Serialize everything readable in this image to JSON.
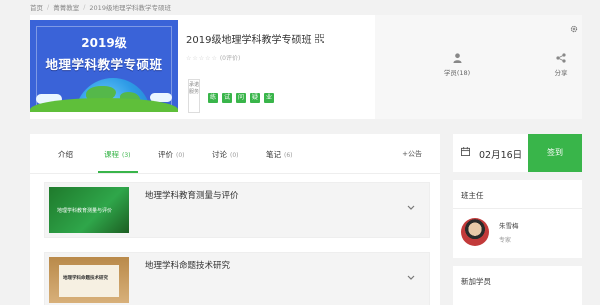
{
  "breadcrumb": [
    "首页",
    "菁菁教室",
    "2019级地理学科教学专硕班"
  ],
  "course": {
    "banner_line1": "2019级",
    "banner_line2": "地理学科教学专硕班",
    "title": "2019级地理学科教学专硕班",
    "rating_text": "(0评价)",
    "rating_stars": "☆☆☆☆☆",
    "service_label": "承诺服务",
    "service_icons": [
      "练",
      "试",
      "问",
      "疑",
      "业"
    ]
  },
  "stats": {
    "students_label": "学员(18)",
    "share_label": "分享"
  },
  "tabs": [
    {
      "label": "介绍",
      "count": ""
    },
    {
      "label": "课程",
      "count": "(3)"
    },
    {
      "label": "评价",
      "count": "(0)"
    },
    {
      "label": "讨论",
      "count": "(0)"
    },
    {
      "label": "笔记",
      "count": "(6)"
    }
  ],
  "notice_label": "+公告",
  "lessons": [
    {
      "title": "地理学科教育测量与评价",
      "thumb_text": "地理学科教育测量与评价"
    },
    {
      "title": "地理学科命题技术研究",
      "thumb_text": "地理学科命题技术研究"
    }
  ],
  "signin": {
    "date": "02月16日",
    "button": "签到"
  },
  "teacher": {
    "heading": "班主任",
    "name": "朱雪梅",
    "role": "专家"
  },
  "new_students": {
    "heading": "新加学员"
  },
  "colors": {
    "accent_green": "#39b54a",
    "banner_blue": "#3a63d8"
  }
}
